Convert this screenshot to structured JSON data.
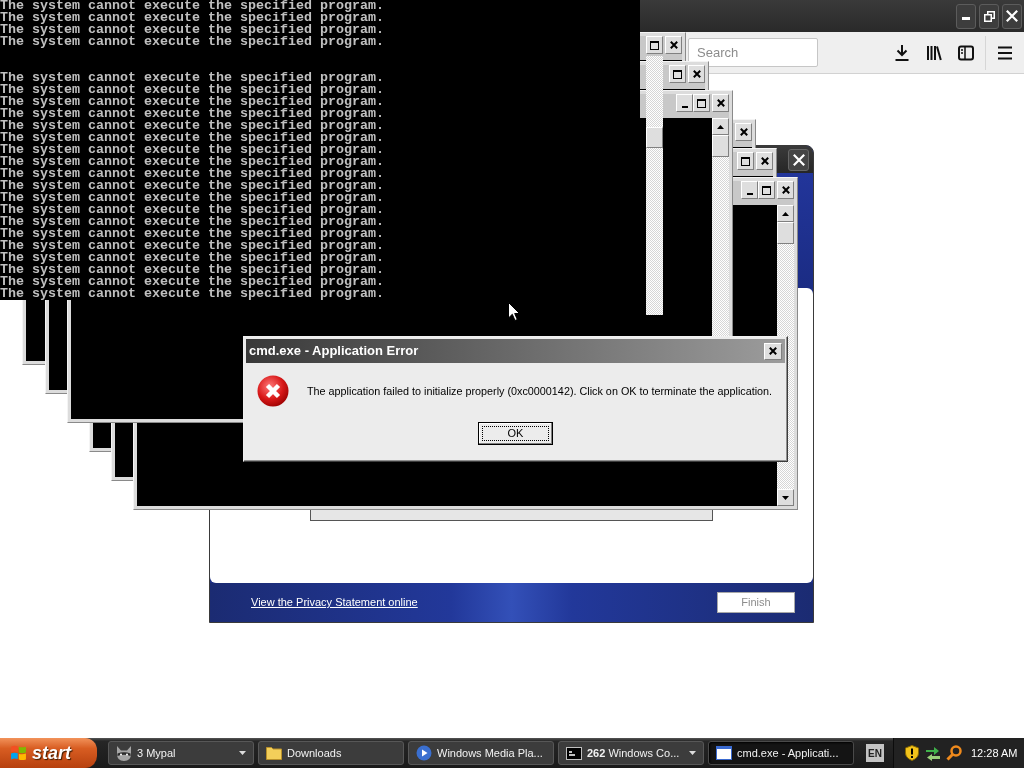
{
  "browser": {
    "search": {
      "placeholder": "Search"
    }
  },
  "console": {
    "blocks": [
      {
        "lines": [
          "The system cannot execute the specified program.",
          "The system cannot execute the specified program.",
          "The system cannot execute the specified program.",
          "The system cannot execute the specified program."
        ]
      },
      {
        "lines": [
          "The system cannot execute the specified program.",
          "The system cannot execute the specified program.",
          "The system cannot execute the specified program.",
          "The system cannot execute the specified program.",
          "The system cannot execute the specified program.",
          "The system cannot execute the specified program.",
          "The system cannot execute the specified program.",
          "The system cannot execute the specified program.",
          "The system cannot execute the specified program.",
          "The system cannot execute the specified program.",
          "The system cannot execute the specified program.",
          "The system cannot execute the specified program.",
          "The system cannot execute the specified program.",
          "The system cannot execute the specified program.",
          "The system cannot execute the specified program.",
          "The system cannot execute the specified program.",
          "The system cannot execute the specified program.",
          "The system cannot execute the specified program.",
          "The system cannot execute the specified program."
        ]
      }
    ]
  },
  "wizard": {
    "privacy_link": "View the Privacy Statement online",
    "finish_button": {
      "label": "Finish",
      "disabled": true
    }
  },
  "error_dialog": {
    "title": "cmd.exe - Application Error",
    "message": "The application failed to initialize properly (0xc0000142). Click on OK to terminate the application.",
    "ok_button": {
      "label": "OK",
      "focused": true
    }
  },
  "taskbar": {
    "start_label": "start",
    "buttons": [
      {
        "label": "3 Mypal",
        "kind": "browser",
        "grouped": true,
        "selected": false
      },
      {
        "label": "Downloads",
        "kind": "folder",
        "grouped": false,
        "selected": false
      },
      {
        "label": "Windows Media Pla...",
        "kind": "media",
        "grouped": false,
        "selected": false
      },
      {
        "label": "**262** Windows Co...",
        "kind": "console",
        "grouped": true,
        "selected": false
      },
      {
        "label": "cmd.exe - Applicati...",
        "kind": "window",
        "grouped": false,
        "selected": true
      }
    ],
    "language": "EN",
    "clock": "12:28 AM"
  }
}
